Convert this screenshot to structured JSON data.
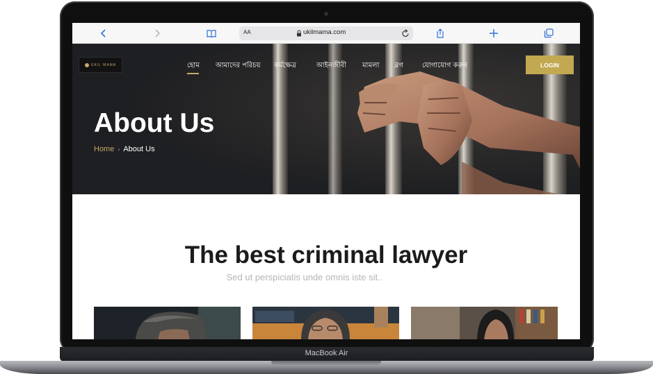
{
  "device": {
    "label": "MacBook Air"
  },
  "browser": {
    "text_size_label": "AA",
    "url": "ukilmama.com",
    "icons": [
      "back-icon",
      "forward-icon",
      "bookmarks-icon",
      "lock-icon",
      "reload-icon",
      "share-icon",
      "new-tab-icon",
      "tabs-icon"
    ]
  },
  "site": {
    "nav": [
      "হোম",
      "আমাদের পরিচয়",
      "কর্মক্ষেত্র",
      "আইনজীবী",
      "মামলা",
      "ব্লগ",
      "যোগাযোগ করুন"
    ],
    "active_nav": "হোম",
    "login_label": "LOGIN",
    "accent_color": "#c2a951"
  },
  "hero": {
    "title": "About Us",
    "breadcrumb_home": "Home",
    "breadcrumb_separator": "›",
    "breadcrumb_current": "About Us"
  },
  "section": {
    "title": "The best criminal lawyer",
    "subtitle": "Sed ut perspiciatis unde omnis iste sit.."
  },
  "cards": [
    {
      "image": "lawyer-portrait-1"
    },
    {
      "image": "lawyer-portrait-2"
    },
    {
      "image": "lawyer-portrait-3"
    }
  ]
}
